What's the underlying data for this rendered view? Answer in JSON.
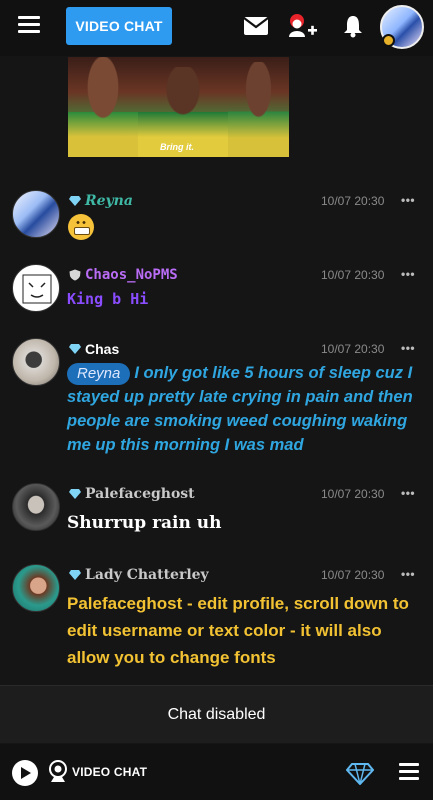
{
  "header": {
    "video_chat_label": "VIDEO CHAT",
    "icons": [
      "menu-icon",
      "mail-icon",
      "add-friend-icon",
      "bell-icon",
      "profile-avatar"
    ]
  },
  "gif": {
    "caption": "Bring it."
  },
  "messages": [
    {
      "username": "Reyna",
      "time": "10/07 20:30",
      "text": "",
      "emoji": "grimacing-face",
      "name_color": "#3fb9a6",
      "rank_icon": "diamond-icon"
    },
    {
      "username": "Chaos_NoPMS",
      "time": "10/07 20:30",
      "text": "King b Hi",
      "name_color": "#b96cf5",
      "text_color": "#8a4cff",
      "rank_icon": "shield-icon"
    },
    {
      "username": "Chas",
      "time": "10/07 20:30",
      "mention": "Reyna",
      "text": "I only got like 5 hours of sleep cuz I stayed up pretty late crying in pain and then people are smoking weed coughing waking me up this morning I was mad",
      "name_color": "#ffffff",
      "text_color": "#2fa6e0",
      "rank_icon": "diamond-icon"
    },
    {
      "username": "Palefaceghost",
      "time": "10/07 20:30",
      "text": "Shurrup rain uh",
      "name_color": "#c9c9c9",
      "text_color": "#ffffff",
      "rank_icon": "diamond-icon"
    },
    {
      "username": "Lady Chatterley",
      "time": "10/07 20:30",
      "text": "Palefaceghost - edit profile, scroll down to edit username or text color - it will also allow you to change fonts",
      "name_color": "#c9c9c9",
      "text_color": "#f2c233",
      "rank_icon": "diamond-icon"
    }
  ],
  "more_label": "•••",
  "composer": {
    "disabled_text": "Chat disabled"
  },
  "footer": {
    "video_chat_label": "VIDEO CHAT"
  }
}
